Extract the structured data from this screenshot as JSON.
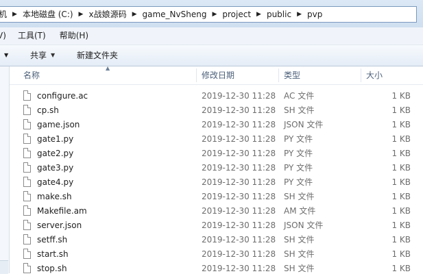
{
  "address": {
    "segments": [
      "机",
      "本地磁盘 (C:)",
      "x战娘源码",
      "game_NvSheng",
      "project",
      "public",
      "pvp"
    ]
  },
  "menu": {
    "items": [
      "V)",
      "工具(T)",
      "帮助(H)"
    ]
  },
  "toolbar": {
    "share_label": "共享",
    "new_folder_label": "新建文件夹"
  },
  "columns": {
    "name": "名称",
    "modified": "修改日期",
    "type": "类型",
    "size": "大小"
  },
  "files": [
    {
      "name": "configure.ac",
      "modified": "2019-12-30 11:28",
      "type": "AC 文件",
      "size": "1 KB"
    },
    {
      "name": "cp.sh",
      "modified": "2019-12-30 11:28",
      "type": "SH 文件",
      "size": "1 KB"
    },
    {
      "name": "game.json",
      "modified": "2019-12-30 11:28",
      "type": "JSON 文件",
      "size": "1 KB"
    },
    {
      "name": "gate1.py",
      "modified": "2019-12-30 11:28",
      "type": "PY 文件",
      "size": "1 KB"
    },
    {
      "name": "gate2.py",
      "modified": "2019-12-30 11:28",
      "type": "PY 文件",
      "size": "1 KB"
    },
    {
      "name": "gate3.py",
      "modified": "2019-12-30 11:28",
      "type": "PY 文件",
      "size": "1 KB"
    },
    {
      "name": "gate4.py",
      "modified": "2019-12-30 11:28",
      "type": "PY 文件",
      "size": "1 KB"
    },
    {
      "name": "make.sh",
      "modified": "2019-12-30 11:28",
      "type": "SH 文件",
      "size": "1 KB"
    },
    {
      "name": "Makefile.am",
      "modified": "2019-12-30 11:28",
      "type": "AM 文件",
      "size": "1 KB"
    },
    {
      "name": "server.json",
      "modified": "2019-12-30 11:28",
      "type": "JSON 文件",
      "size": "1 KB"
    },
    {
      "name": "setff.sh",
      "modified": "2019-12-30 11:28",
      "type": "SH 文件",
      "size": "1 KB"
    },
    {
      "name": "start.sh",
      "modified": "2019-12-30 11:28",
      "type": "SH 文件",
      "size": "1 KB"
    },
    {
      "name": "stop.sh",
      "modified": "2019-12-30 11:28",
      "type": "SH 文件",
      "size": "1 KB"
    }
  ],
  "colors": {
    "header_text": "#4c607a",
    "secondary_text": "#6d6d6d",
    "toolbar_bg": "#e4ecf6"
  }
}
